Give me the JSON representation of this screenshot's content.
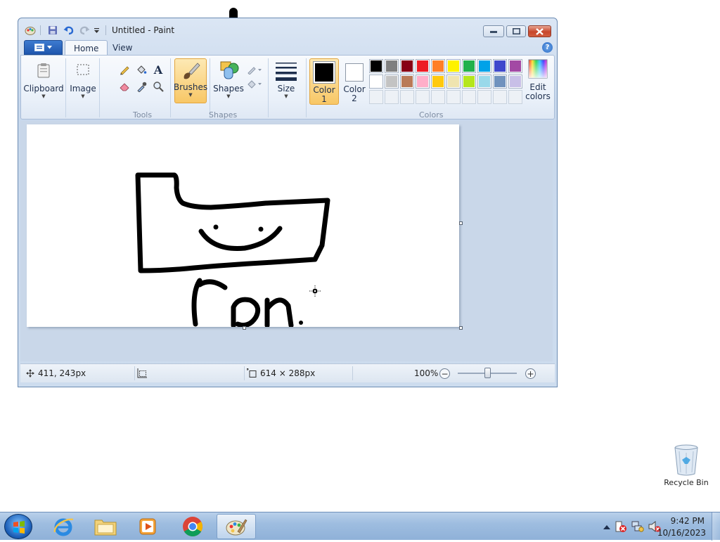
{
  "window": {
    "title": "Untitled - Paint"
  },
  "tabs": [
    {
      "label": "Home",
      "active": true
    },
    {
      "label": "View",
      "active": false
    }
  ],
  "ribbon": {
    "clipboard_label": "Clipboard",
    "image_label": "Image",
    "tools_group": "Tools",
    "brushes_label": "Brushes",
    "shapes_label": "Shapes",
    "shapes_group": "Shapes",
    "size_label": "Size",
    "color1_label_1": "Color",
    "color1_label_2": "1",
    "color2_label_1": "Color",
    "color2_label_2": "2",
    "colors_group": "Colors",
    "edit_colors_1": "Edit",
    "edit_colors_2": "colors",
    "color1_value": "#000000",
    "color2_value": "#ffffff",
    "palette": [
      "#000000",
      "#7f7f7f",
      "#880015",
      "#ed1c24",
      "#ff7f27",
      "#fff200",
      "#22b14c",
      "#00a2e8",
      "#3f48cc",
      "#a349a4",
      "#ffffff",
      "#c3c3c3",
      "#b97a57",
      "#ffaec9",
      "#ffc90e",
      "#efe4b0",
      "#b5e61d",
      "#99d9ea",
      "#7092be",
      "#c8bfe7",
      "",
      "",
      "",
      "",
      "",
      "",
      "",
      "",
      "",
      ""
    ]
  },
  "status": {
    "cursor_pos": "411, 243px",
    "selection_size": "",
    "image_size": "614 × 288px",
    "zoom": "100%",
    "zoom_level": 0.5
  },
  "desktop": {
    "recycle_bin_label": "Recycle Bin"
  },
  "taskbar": {
    "apps": [
      "internet-explorer",
      "file-explorer",
      "media-player",
      "chrome",
      "paint"
    ],
    "clock_time": "9:42 PM",
    "clock_date": "10/16/2023"
  }
}
